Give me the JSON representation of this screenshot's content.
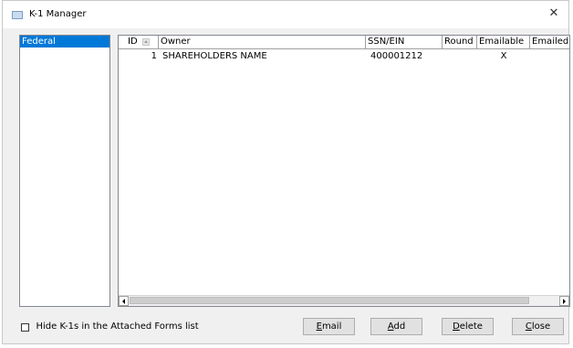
{
  "window": {
    "title": "K-1 Manager",
    "close_glyph": "✕"
  },
  "jurisdictions": {
    "items": [
      {
        "label": "Federal",
        "selected": true
      }
    ]
  },
  "grid": {
    "columns": [
      "ID",
      "Owner",
      "SSN/EIN",
      "Round",
      "Emailable",
      "Emailed"
    ],
    "rows": [
      {
        "id": "1",
        "owner": "SHAREHOLDERS NAME",
        "ssn_ein": "400001212",
        "round": "",
        "emailable": "X",
        "emailed": ""
      }
    ]
  },
  "options": {
    "hide_k1s_label": "Hide K-1s in the Attached Forms list",
    "hide_k1s_checked": false
  },
  "buttons": {
    "email": {
      "accel": "E",
      "rest": "mail"
    },
    "add": {
      "accel": "A",
      "rest": "dd"
    },
    "delete": {
      "accel": "D",
      "rest": "elete"
    },
    "close": {
      "accel": "C",
      "rest": "lose"
    }
  },
  "colors": {
    "selection": "#0078d7",
    "dialog_bg": "#f0f0f0"
  }
}
